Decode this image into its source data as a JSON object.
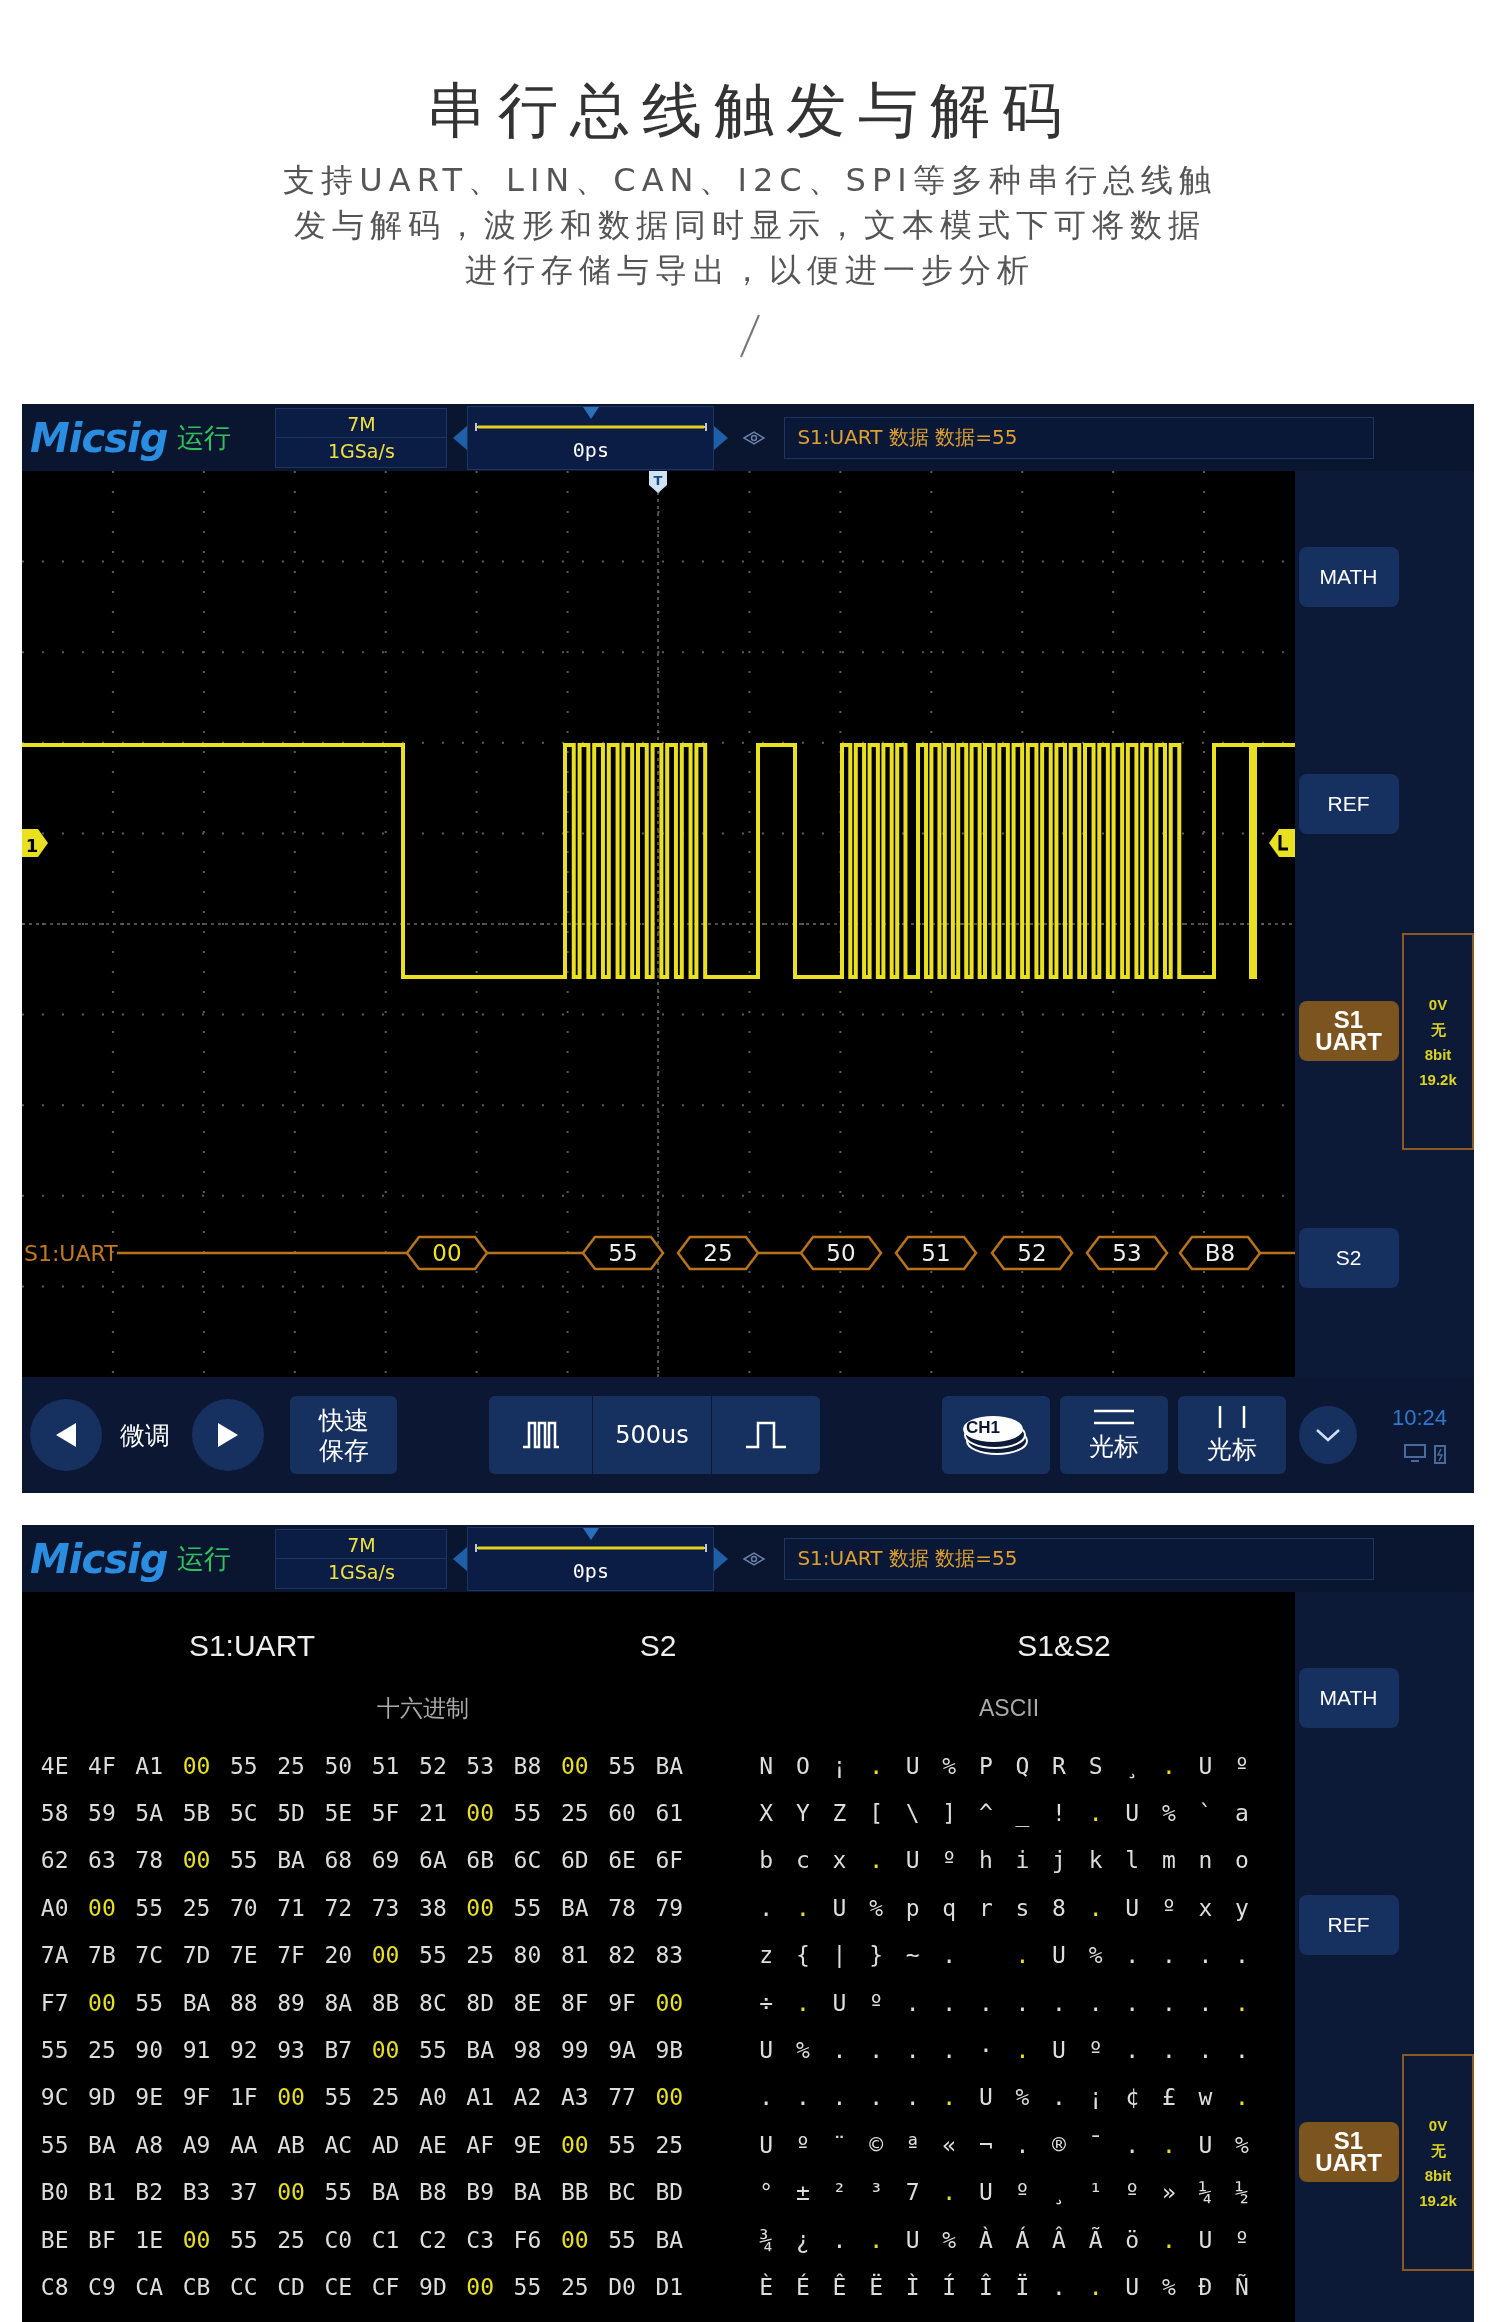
{
  "header": {
    "title": "串行总线触发与解码",
    "description_lines": [
      "支持UART、LIN、CAN、I2C、SPI等多种串行总线触",
      "发与解码，波形和数据同时显示，文本模式下可将数据",
      "进行存储与导出，以便进一步分析"
    ]
  },
  "scope_views": [
    {
      "kind": "waveform",
      "top_bar": {
        "brand": "Micsig",
        "run_state": "运行",
        "memory_depth": "7M",
        "sample_rate": "1GSa/s",
        "time_offset": "0ps",
        "trigger_info": "S1:UART 数据 数据=55"
      },
      "waveform": {
        "channel_marker": "1",
        "trigger_marker": "T",
        "bus_label": "S1:UART",
        "decode_bubbles": [
          {
            "text": "00",
            "delimiter": true
          },
          {
            "text": "55",
            "delimiter": false
          },
          {
            "text": "25",
            "delimiter": false
          },
          {
            "text": "50",
            "delimiter": false
          },
          {
            "text": "51",
            "delimiter": false
          },
          {
            "text": "52",
            "delimiter": false
          },
          {
            "text": "53",
            "delimiter": false
          },
          {
            "text": "B8",
            "delimiter": false
          }
        ]
      },
      "side_panel": {
        "buttons": [
          {
            "lines": [
              "MATH"
            ],
            "selected": false
          },
          {
            "lines": [
              "REF"
            ],
            "selected": false
          },
          {
            "lines": [
              "S1",
              "UART"
            ],
            "selected": true
          },
          {
            "lines": [
              "S2"
            ],
            "selected": false
          }
        ],
        "bus_settings": [
          "0V",
          "无",
          "8bit",
          "19.2k"
        ]
      },
      "bottom_bar": {
        "fine_tune": "微调",
        "quick_save": "快速保存",
        "timebase": "500us",
        "channel": "CH1",
        "cursor_labels": [
          "光标",
          "光标"
        ],
        "time": "10:24"
      }
    },
    {
      "kind": "table",
      "top_bar": {
        "brand": "Micsig",
        "run_state": "运行",
        "memory_depth": "7M",
        "sample_rate": "1GSa/s",
        "time_offset": "0ps",
        "trigger_info": "S1:UART 数据 数据=55"
      },
      "table": {
        "headings": [
          "S1:UART",
          "S2",
          "S1&S2"
        ],
        "hex_label": "十六进制",
        "ascii_label": "ASCII",
        "rows": [
          {
            "hex": [
              "4E",
              "4F",
              "A1",
              "00",
              "55",
              "25",
              "50",
              "51",
              "52",
              "53",
              "B8",
              "00",
              "55",
              "BA"
            ],
            "ascii": [
              "N",
              "O",
              "¡",
              ".",
              "U",
              "%",
              "P",
              "Q",
              "R",
              "S",
              "¸",
              ".",
              "U",
              "º"
            ],
            "delimiters": [
              false,
              false,
              false,
              true,
              false,
              false,
              false,
              false,
              false,
              false,
              false,
              true,
              false,
              false
            ]
          },
          {
            "hex": [
              "58",
              "59",
              "5A",
              "5B",
              "5C",
              "5D",
              "5E",
              "5F",
              "21",
              "00",
              "55",
              "25",
              "60",
              "61"
            ],
            "ascii": [
              "X",
              "Y",
              "Z",
              "[",
              "\\",
              "]",
              "^",
              "_",
              "!",
              ".",
              "U",
              "%",
              "`",
              "a"
            ],
            "delimiters": [
              false,
              false,
              false,
              false,
              false,
              false,
              false,
              false,
              false,
              true,
              false,
              false,
              false,
              false
            ]
          },
          {
            "hex": [
              "62",
              "63",
              "78",
              "00",
              "55",
              "BA",
              "68",
              "69",
              "6A",
              "6B",
              "6C",
              "6D",
              "6E",
              "6F"
            ],
            "ascii": [
              "b",
              "c",
              "x",
              ".",
              "U",
              "º",
              "h",
              "i",
              "j",
              "k",
              "l",
              "m",
              "n",
              "o"
            ],
            "delimiters": [
              false,
              false,
              false,
              true,
              false,
              false,
              false,
              false,
              false,
              false,
              false,
              false,
              false,
              false
            ]
          },
          {
            "hex": [
              "A0",
              "00",
              "55",
              "25",
              "70",
              "71",
              "72",
              "73",
              "38",
              "00",
              "55",
              "BA",
              "78",
              "79"
            ],
            "ascii": [
              ".",
              ".",
              "U",
              "%",
              "p",
              "q",
              "r",
              "s",
              "8",
              ".",
              "U",
              "º",
              "x",
              "y"
            ],
            "delimiters": [
              false,
              true,
              false,
              false,
              false,
              false,
              false,
              false,
              false,
              true,
              false,
              false,
              false,
              false
            ]
          },
          {
            "hex": [
              "7A",
              "7B",
              "7C",
              "7D",
              "7E",
              "7F",
              "20",
              "00",
              "55",
              "25",
              "80",
              "81",
              "82",
              "83"
            ],
            "ascii": [
              "z",
              "{",
              "|",
              "}",
              "~",
              ".",
              {
                "kind": "space"
              },
              ".",
              "U",
              "%",
              ".",
              ".",
              ".",
              "."
            ],
            "delimiters": [
              false,
              false,
              false,
              false,
              false,
              false,
              false,
              true,
              false,
              false,
              false,
              false,
              false,
              false
            ]
          },
          {
            "hex": [
              "F7",
              "00",
              "55",
              "BA",
              "88",
              "89",
              "8A",
              "8B",
              "8C",
              "8D",
              "8E",
              "8F",
              "9F",
              "00"
            ],
            "ascii": [
              "÷",
              ".",
              "U",
              "º",
              ".",
              ".",
              ".",
              ".",
              ".",
              ".",
              ".",
              ".",
              ".",
              "."
            ],
            "delimiters": [
              false,
              true,
              false,
              false,
              false,
              false,
              false,
              false,
              false,
              false,
              false,
              false,
              false,
              true
            ]
          },
          {
            "hex": [
              "55",
              "25",
              "90",
              "91",
              "92",
              "93",
              "B7",
              "00",
              "55",
              "BA",
              "98",
              "99",
              "9A",
              "9B"
            ],
            "ascii": [
              "U",
              "%",
              ".",
              ".",
              ".",
              ".",
              "·",
              ".",
              "U",
              "º",
              ".",
              ".",
              ".",
              "."
            ],
            "delimiters": [
              false,
              false,
              false,
              false,
              false,
              false,
              false,
              true,
              false,
              false,
              false,
              false,
              false,
              false
            ]
          },
          {
            "hex": [
              "9C",
              "9D",
              "9E",
              "9F",
              "1F",
              "00",
              "55",
              "25",
              "A0",
              "A1",
              "A2",
              "A3",
              "77",
              "00"
            ],
            "ascii": [
              ".",
              ".",
              ".",
              ".",
              ".",
              ".",
              "U",
              "%",
              ".",
              "¡",
              "¢",
              "£",
              "w",
              "."
            ],
            "delimiters": [
              false,
              false,
              false,
              false,
              false,
              true,
              false,
              false,
              false,
              false,
              false,
              false,
              false,
              true
            ]
          },
          {
            "hex": [
              "55",
              "BA",
              "A8",
              "A9",
              "AA",
              "AB",
              "AC",
              "AD",
              "AE",
              "AF",
              "9E",
              "00",
              "55",
              "25"
            ],
            "ascii": [
              "U",
              "º",
              "¨",
              "©",
              "ª",
              "«",
              "¬",
              ".",
              "®",
              "¯",
              ".",
              ".",
              "U",
              "%"
            ],
            "delimiters": [
              false,
              false,
              false,
              false,
              false,
              false,
              false,
              false,
              false,
              false,
              false,
              true,
              false,
              false
            ]
          },
          {
            "hex": [
              "B0",
              "B1",
              "B2",
              "B3",
              "37",
              "00",
              "55",
              "BA",
              "B8",
              "B9",
              "BA",
              "BB",
              "BC",
              "BD"
            ],
            "ascii": [
              "°",
              "±",
              "²",
              "³",
              "7",
              ".",
              "U",
              "º",
              "¸",
              "¹",
              "º",
              "»",
              "¼",
              "½"
            ],
            "delimiters": [
              false,
              false,
              false,
              false,
              false,
              true,
              false,
              false,
              false,
              false,
              false,
              false,
              false,
              false
            ]
          },
          {
            "hex": [
              "BE",
              "BF",
              "1E",
              "00",
              "55",
              "25",
              "C0",
              "C1",
              "C2",
              "C3",
              "F6",
              "00",
              "55",
              "BA"
            ],
            "ascii": [
              "¾",
              "¿",
              ".",
              ".",
              "U",
              "%",
              "À",
              "Á",
              "Â",
              "Ã",
              "ö",
              ".",
              "U",
              "º"
            ],
            "delimiters": [
              false,
              false,
              false,
              true,
              false,
              false,
              false,
              false,
              false,
              false,
              false,
              true,
              false,
              false
            ]
          },
          {
            "hex": [
              "C8",
              "C9",
              "CA",
              "CB",
              "CC",
              "CD",
              "CE",
              "CF",
              "9D",
              "00",
              "55",
              "25",
              "D0",
              "D1"
            ],
            "ascii": [
              "È",
              "É",
              "Ê",
              "Ë",
              "Ì",
              "Í",
              "Î",
              "Ï",
              ".",
              ".",
              "U",
              "%",
              "Ð",
              "Ñ"
            ],
            "delimiters": [
              false,
              false,
              false,
              false,
              false,
              false,
              false,
              false,
              false,
              true,
              false,
              false,
              false,
              false
            ]
          }
        ]
      },
      "side_panel": {
        "buttons": [
          {
            "lines": [
              "MATH"
            ],
            "selected": false
          },
          {
            "lines": [
              "REF"
            ],
            "selected": false
          },
          {
            "lines": [
              "S1",
              "UART"
            ],
            "selected": true
          }
        ],
        "bus_settings": [
          "0V",
          "无",
          "8bit",
          "19.2k"
        ]
      }
    }
  ]
}
